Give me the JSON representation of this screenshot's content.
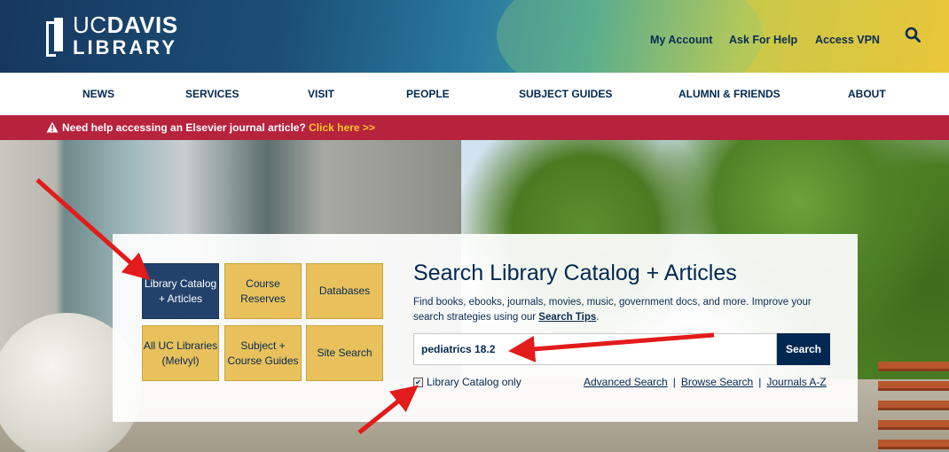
{
  "header": {
    "logo_top_light": "UC",
    "logo_top_bold": "DAVIS",
    "logo_bottom": "LIBRARY",
    "links": [
      "My Account",
      "Ask For Help",
      "Access VPN"
    ],
    "search_icon": "search-icon"
  },
  "nav": {
    "items": [
      "NEWS",
      "SERVICES",
      "VISIT",
      "PEOPLE",
      "SUBJECT GUIDES",
      "ALUMNI & FRIENDS",
      "ABOUT"
    ]
  },
  "alert": {
    "icon": "warning-icon",
    "text": "Need help accessing an Elsevier journal article?",
    "link": "Click here >>"
  },
  "search": {
    "tiles": [
      "Library Catalog + Articles",
      "Course Reserves",
      "Databases",
      "All UC Libraries (Melvyl)",
      "Subject + Course Guides",
      "Site Search"
    ],
    "title": "Search Library Catalog + Articles",
    "description": "Find books, ebooks, journals, movies, music, government docs, and more. Improve your search strategies using our",
    "tips_link": "Search Tips",
    "tips_suffix": ".",
    "input_value": "pediatrics 18.2",
    "button": "Search",
    "checkbox_label": "Library Catalog only",
    "checkbox_checked": true,
    "links": [
      "Advanced Search",
      "Browse Search",
      "Journals A-Z"
    ],
    "separator": "|"
  },
  "colors": {
    "navy": "#022851",
    "gold": "#e9c15c",
    "alert_red": "#b7223d",
    "alert_link": "#ffc627",
    "annotation_arrow": "#e21b1b"
  }
}
